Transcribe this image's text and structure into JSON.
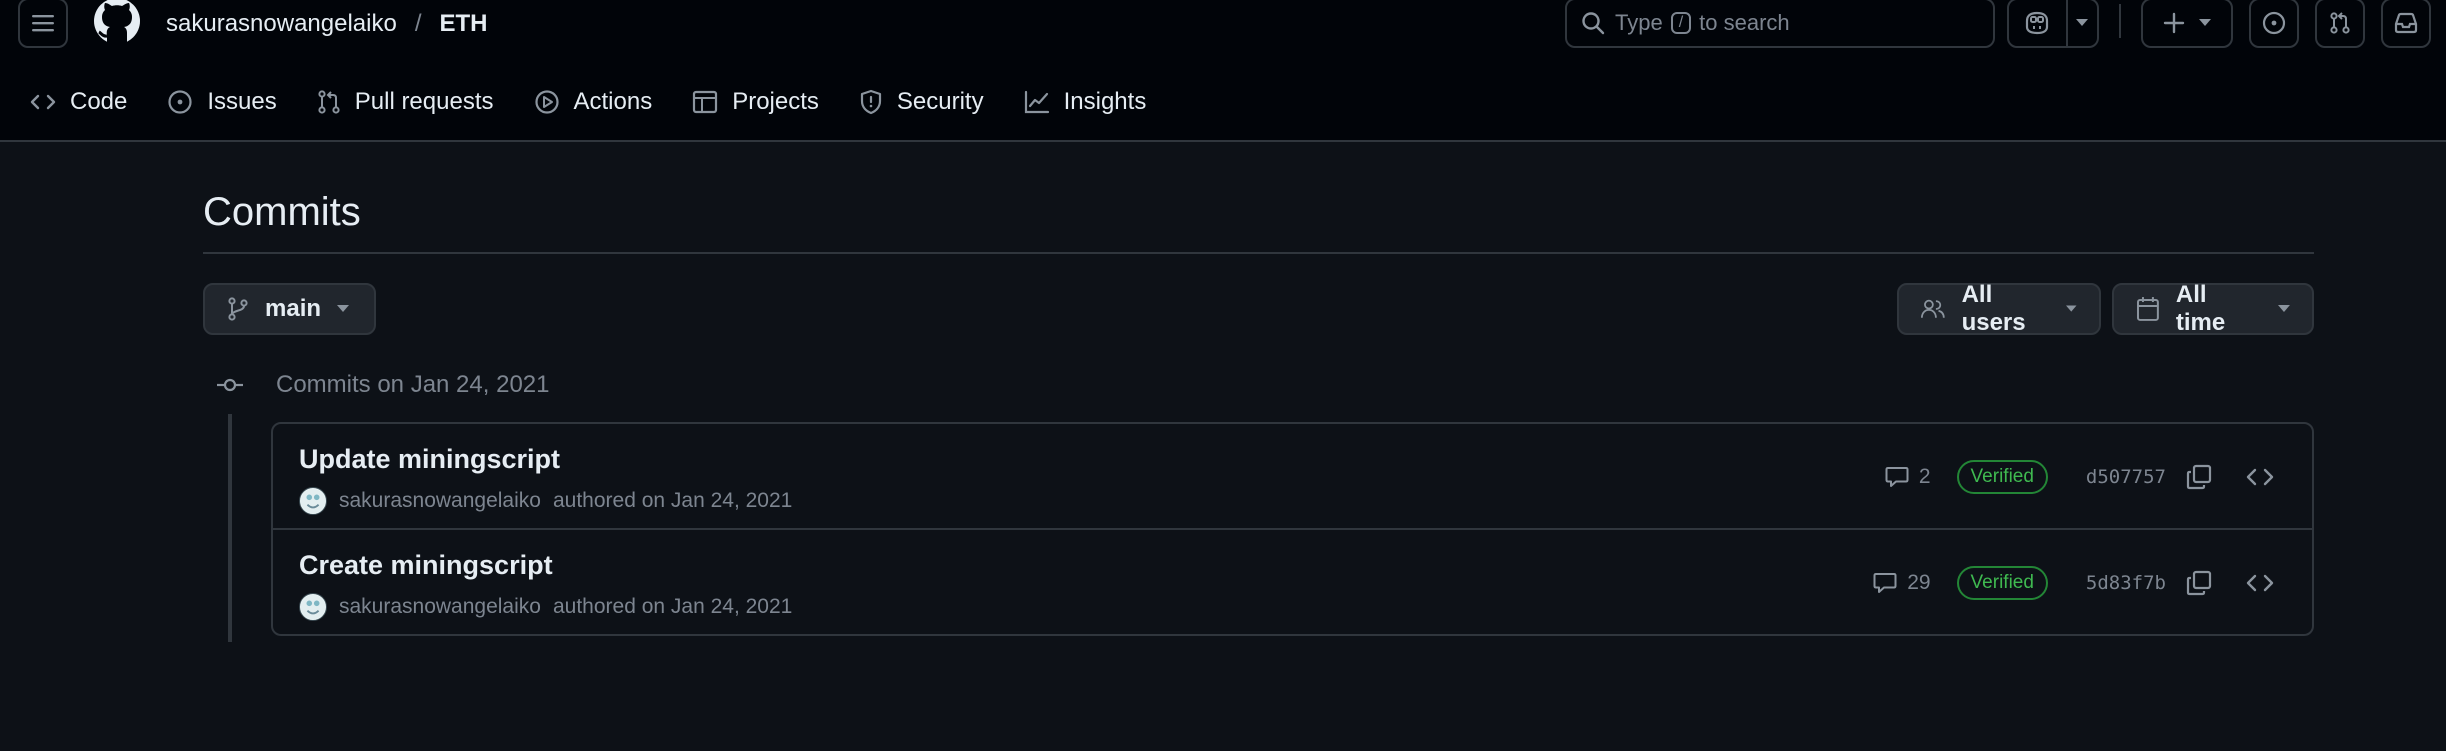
{
  "header": {
    "owner": "sakurasnowangelaiko",
    "separator": "/",
    "repo": "ETH",
    "search_prefix": "Type",
    "search_key": "/",
    "search_suffix": "to search"
  },
  "tabs": [
    {
      "label": "Code",
      "icon": "code-icon"
    },
    {
      "label": "Issues",
      "icon": "issue-opened-icon"
    },
    {
      "label": "Pull requests",
      "icon": "git-pull-request-icon"
    },
    {
      "label": "Actions",
      "icon": "play-icon"
    },
    {
      "label": "Projects",
      "icon": "table-icon"
    },
    {
      "label": "Security",
      "icon": "shield-icon"
    },
    {
      "label": "Insights",
      "icon": "graph-icon"
    }
  ],
  "page": {
    "title": "Commits",
    "branch": "main",
    "users_filter": "All users",
    "time_filter": "All time"
  },
  "timeline": {
    "label": "Commits on Jan 24, 2021"
  },
  "commits": [
    {
      "title": "Update miningscript",
      "author": "sakurasnowangelaiko",
      "meta": "authored on Jan 24, 2021",
      "comments": "2",
      "badge": "Verified",
      "sha": "d507757"
    },
    {
      "title": "Create miningscript",
      "author": "sakurasnowangelaiko",
      "meta": "authored on Jan 24, 2021",
      "comments": "29",
      "badge": "Verified",
      "sha": "5d83f7b"
    }
  ],
  "colors": {
    "background": "#0d1117",
    "header_bg": "#010409",
    "border": "#30363d",
    "muted_text": "#7d8590",
    "verified_green": "#3fb950"
  }
}
